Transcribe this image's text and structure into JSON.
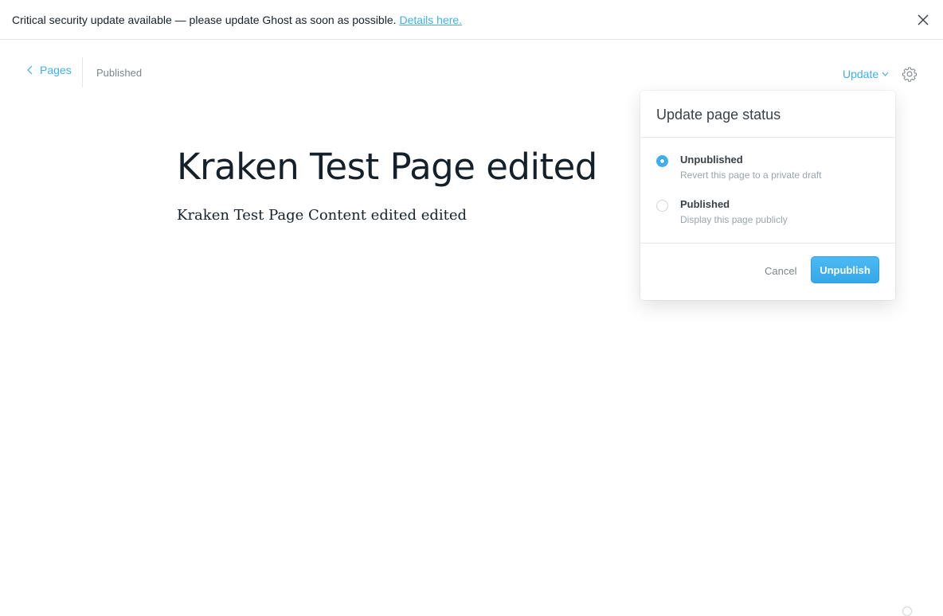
{
  "alert": {
    "message": "Critical security update available — please update Ghost as soon as possible.",
    "link_text": "Details here."
  },
  "header": {
    "back_label": "Pages",
    "status": "Published",
    "update_label": "Update"
  },
  "post": {
    "title": "Kraken Test Page edited",
    "content": "Kraken Test Page Content edited edited"
  },
  "dropdown": {
    "title": "Update page status",
    "options": [
      {
        "label": "Unpublished",
        "description": "Revert this page to a private draft",
        "selected": true
      },
      {
        "label": "Published",
        "description": "Display this page publicly",
        "selected": false
      }
    ],
    "cancel_label": "Cancel",
    "confirm_label": "Unpublish"
  },
  "colors": {
    "accent": "#3eb0ef",
    "text": "#15212a",
    "muted": "#7d878a",
    "border": "#e5e8ea"
  },
  "icons": [
    "close-icon",
    "chevron-left-icon",
    "chevron-down-icon",
    "gear-icon"
  ]
}
